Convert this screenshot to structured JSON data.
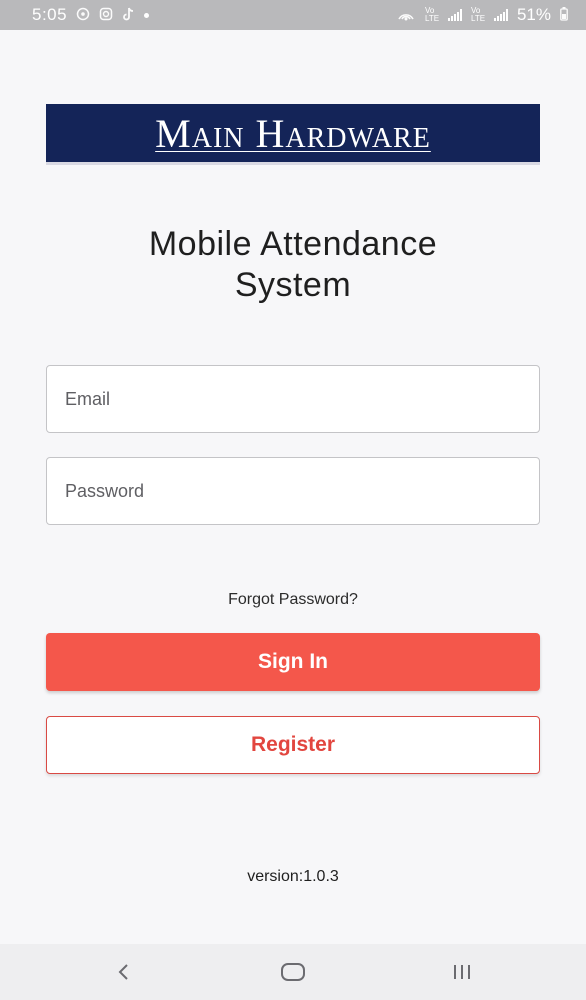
{
  "status_bar": {
    "time": "5:05",
    "battery": "51%",
    "icons": [
      "whatsapp-icon",
      "instagram-icon",
      "tiktok-icon",
      "dot-icon",
      "hotspot-icon",
      "signal-icon",
      "signal-icon-2",
      "battery-icon"
    ],
    "net_label_1": "Vo LTE",
    "net_label_2": "Vo LTE"
  },
  "logo": {
    "text": "Main Hardware"
  },
  "title": {
    "line1": "Mobile Attendance",
    "line2": "System"
  },
  "form": {
    "email_placeholder": "Email",
    "password_placeholder": "Password",
    "forgot_label": "Forgot Password?",
    "signin_label": "Sign In",
    "register_label": "Register"
  },
  "footer": {
    "version": "version:1.0.3"
  },
  "nav": {
    "icons": [
      "back-icon",
      "home-icon",
      "recents-icon"
    ]
  },
  "colors": {
    "primary": "#f4574b",
    "logo_bg": "#142458",
    "register_text": "#e2463f",
    "background": "#f7f7f9"
  }
}
